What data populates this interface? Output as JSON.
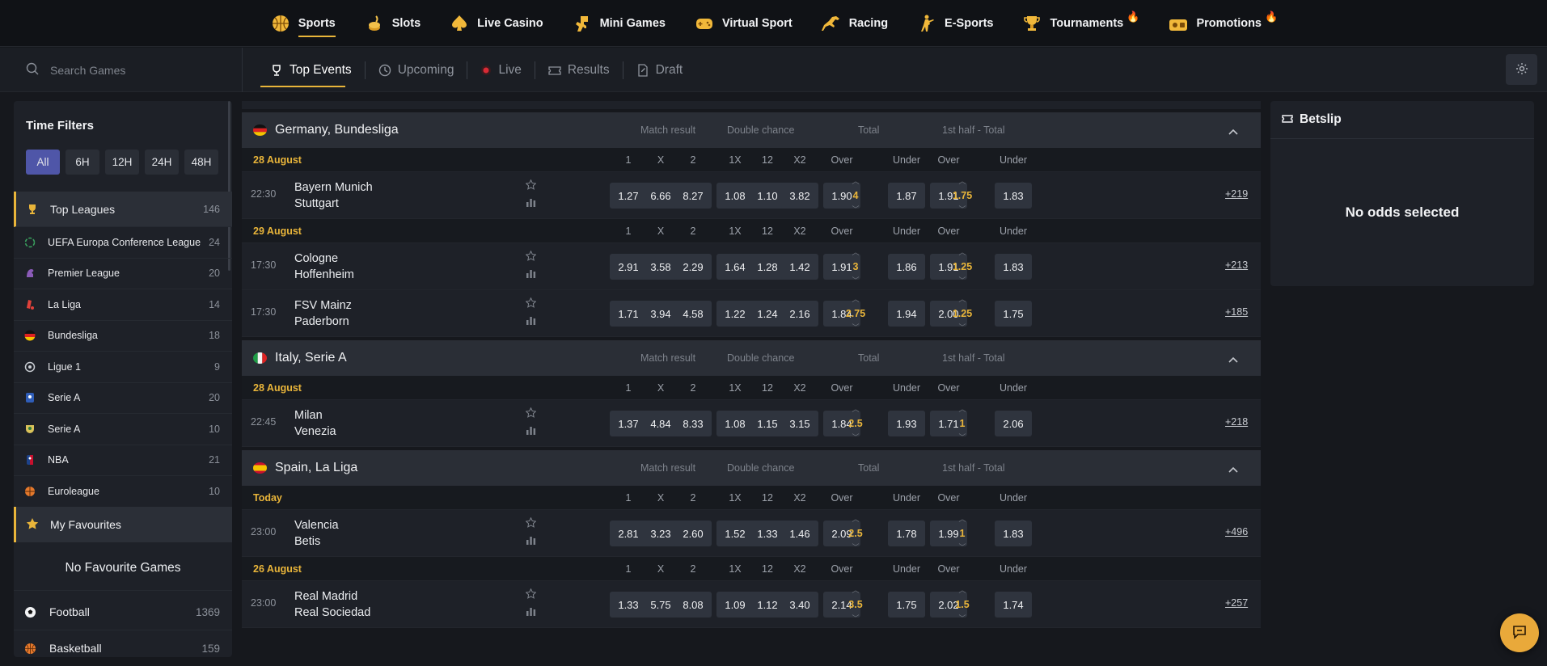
{
  "topnav": [
    {
      "label": "Sports",
      "icon": "basketball-icon",
      "active": true
    },
    {
      "label": "Slots",
      "icon": "coins-icon"
    },
    {
      "label": "Live Casino",
      "icon": "spade-icon"
    },
    {
      "label": "Mini Games",
      "icon": "dinosaur-icon"
    },
    {
      "label": "Virtual Sport",
      "icon": "gamepad-icon"
    },
    {
      "label": "Racing",
      "icon": "horse-icon"
    },
    {
      "label": "E-Sports",
      "icon": "soldier-icon"
    },
    {
      "label": "Tournaments",
      "icon": "trophy-icon",
      "hot": true
    },
    {
      "label": "Promotions",
      "icon": "gift-icon",
      "hot": true
    }
  ],
  "search": {
    "placeholder": "Search Games"
  },
  "tabs": [
    {
      "label": "Top Events",
      "icon": "trophy-icon"
    },
    {
      "label": "Upcoming",
      "icon": "clock-icon"
    },
    {
      "label": "Live",
      "icon": "live-dot-icon"
    },
    {
      "label": "Results",
      "icon": "ticket-icon"
    },
    {
      "label": "Draft",
      "icon": "draft-icon"
    }
  ],
  "sidebar": {
    "time_filters_title": "Time Filters",
    "time_filters": [
      "All",
      "6H",
      "12H",
      "24H",
      "48H"
    ],
    "top_leagues": {
      "label": "Top Leagues",
      "count": "146"
    },
    "leagues": [
      {
        "label": "UEFA Europa Conference League",
        "count": "24",
        "icon": "conference-league-icon"
      },
      {
        "label": "Premier League",
        "count": "20",
        "icon": "premier-league-icon"
      },
      {
        "label": "La Liga",
        "count": "14",
        "icon": "laliga-icon"
      },
      {
        "label": "Bundesliga",
        "count": "18",
        "icon": "germany-flag-icon"
      },
      {
        "label": "Ligue 1",
        "count": "9",
        "icon": "ligue1-icon"
      },
      {
        "label": "Serie A",
        "count": "20",
        "icon": "serie-a-icon"
      },
      {
        "label": "Serie A",
        "count": "10",
        "icon": "serie-a-brazil-icon"
      },
      {
        "label": "NBA",
        "count": "21",
        "icon": "nba-icon"
      },
      {
        "label": "Euroleague",
        "count": "10",
        "icon": "euroleague-icon"
      }
    ],
    "my_favourites": "My Favourites",
    "no_favourites": "No Favourite Games",
    "sports": [
      {
        "label": "Football",
        "count": "1369",
        "icon": "football-icon"
      },
      {
        "label": "Basketball",
        "count": "159",
        "icon": "basketball-icon"
      }
    ]
  },
  "market_headers": {
    "match_result": "Match result",
    "double_chance": "Double chance",
    "total": "Total",
    "first_half_total": "1st half - Total"
  },
  "columns": {
    "c1": "1",
    "cx": "X",
    "c2": "2",
    "c1x": "1X",
    "c12": "12",
    "cx2": "X2",
    "over": "Over",
    "under": "Under"
  },
  "leagues": [
    {
      "name": "Germany, Bundesliga",
      "flag": "germany",
      "groups": [
        {
          "date": "28 August",
          "matches": [
            {
              "time": "22:30",
              "home": "Bayern Munich",
              "away": "Stuttgart",
              "mr": [
                "1.27",
                "6.66",
                "8.27"
              ],
              "dc": [
                "1.08",
                "1.10",
                "3.82"
              ],
              "total_over": "1.90",
              "total_line": "4",
              "total_under": "1.87",
              "h_over": "1.91",
              "h_line": "1.75",
              "h_under": "1.83",
              "more": "+219"
            }
          ]
        },
        {
          "date": "29 August",
          "matches": [
            {
              "time": "17:30",
              "home": "Cologne",
              "away": "Hoffenheim",
              "mr": [
                "2.91",
                "3.58",
                "2.29"
              ],
              "dc": [
                "1.64",
                "1.28",
                "1.42"
              ],
              "total_over": "1.91",
              "total_line": "3",
              "total_under": "1.86",
              "h_over": "1.91",
              "h_line": "1.25",
              "h_under": "1.83",
              "more": "+213"
            },
            {
              "time": "17:30",
              "home": "FSV Mainz",
              "away": "Paderborn",
              "mr": [
                "1.71",
                "3.94",
                "4.58"
              ],
              "dc": [
                "1.22",
                "1.24",
                "2.16"
              ],
              "total_over": "1.84",
              "total_line": "2.75",
              "total_under": "1.94",
              "h_over": "2.00",
              "h_line": "1.25",
              "h_under": "1.75",
              "more": "+185"
            }
          ]
        }
      ]
    },
    {
      "name": "Italy, Serie A",
      "flag": "italy",
      "groups": [
        {
          "date": "28 August",
          "matches": [
            {
              "time": "22:45",
              "home": "Milan",
              "away": "Venezia",
              "mr": [
                "1.37",
                "4.84",
                "8.33"
              ],
              "dc": [
                "1.08",
                "1.15",
                "3.15"
              ],
              "total_over": "1.84",
              "total_line": "2.5",
              "total_under": "1.93",
              "h_over": "1.71",
              "h_line": "1",
              "h_under": "2.06",
              "more": "+218"
            }
          ]
        }
      ]
    },
    {
      "name": "Spain, La Liga",
      "flag": "spain",
      "groups": [
        {
          "date": "Today",
          "matches": [
            {
              "time": "23:00",
              "home": "Valencia",
              "away": "Betis",
              "mr": [
                "2.81",
                "3.23",
                "2.60"
              ],
              "dc": [
                "1.52",
                "1.33",
                "1.46"
              ],
              "total_over": "2.09",
              "total_line": "2.5",
              "total_under": "1.78",
              "h_over": "1.99",
              "h_line": "1",
              "h_under": "1.83",
              "more": "+496"
            }
          ]
        },
        {
          "date": "26 August",
          "matches": [
            {
              "time": "23:00",
              "home": "Real Madrid",
              "away": "Real Sociedad",
              "mr": [
                "1.33",
                "5.75",
                "8.08"
              ],
              "dc": [
                "1.09",
                "1.12",
                "3.40"
              ],
              "total_over": "2.14",
              "total_line": "3.5",
              "total_under": "1.75",
              "h_over": "2.02",
              "h_line": "1.5",
              "h_under": "1.74",
              "more": "+257"
            }
          ]
        }
      ]
    }
  ],
  "betslip": {
    "title": "Betslip",
    "empty": "No odds selected"
  },
  "colors": {
    "accent": "#e9b53a",
    "active_filter": "#4f56a8",
    "bg": "#16181d",
    "panel": "#1e2128",
    "odd_btn": "#2f343e"
  }
}
